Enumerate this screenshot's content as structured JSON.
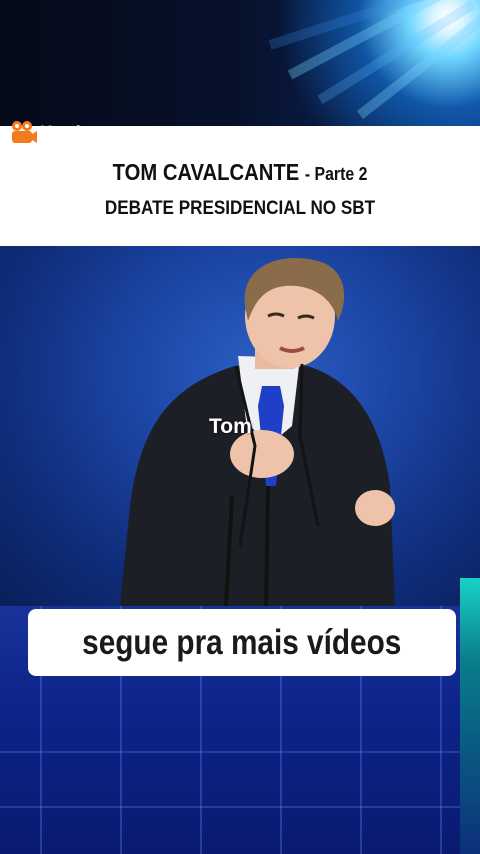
{
  "watermark": {
    "brand": "Kwai",
    "icon": "kwai-camera-icon"
  },
  "title": {
    "main": "TOM CAVALCANTE",
    "part": "- Parte 2",
    "subtitle": "DEBATE PRESIDENCIAL NO SBT"
  },
  "scene": {
    "speaker_label": "Tom"
  },
  "cta": {
    "label": "segue pra mais vídeos"
  },
  "colors": {
    "accent_orange": "#f47a20",
    "stage_blue": "#0e248a",
    "teal": "#19d2c6"
  }
}
